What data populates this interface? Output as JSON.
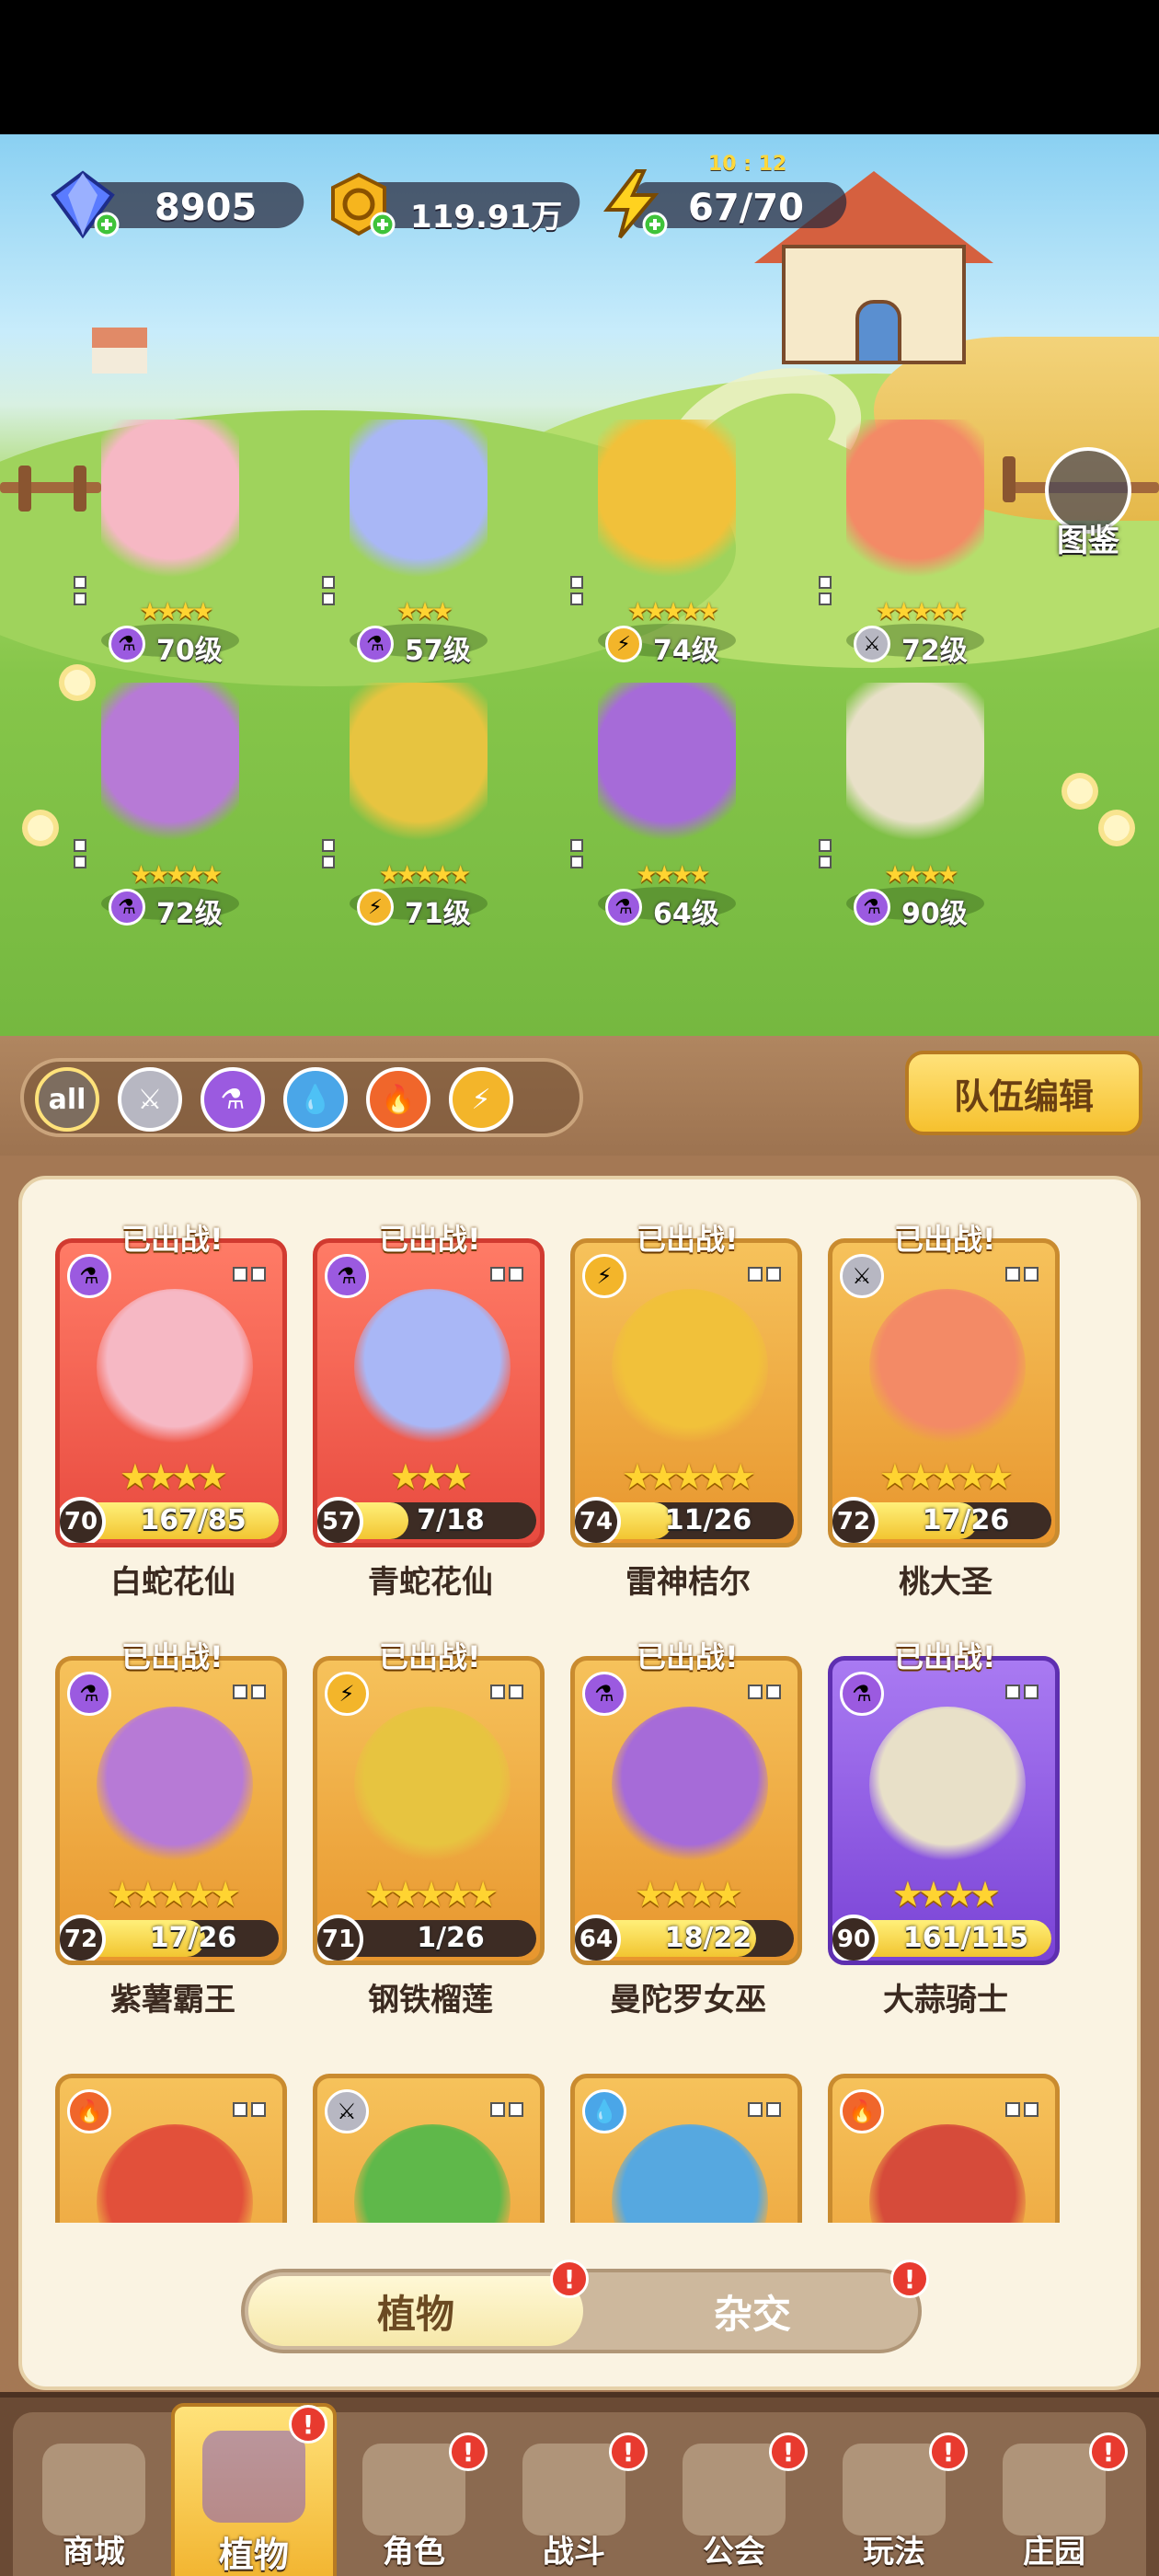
{
  "resources": {
    "gems": "8905",
    "coins": "119.91万",
    "energy": "67/70",
    "energy_timer": "10 : 12"
  },
  "dex_label": "图鉴",
  "field_units": [
    {
      "level": "70级",
      "stars": "★★★★",
      "element": "purple"
    },
    {
      "level": "57级",
      "stars": "★★★",
      "element": "purple"
    },
    {
      "level": "74级",
      "stars": "★★★★★",
      "element": "lightning"
    },
    {
      "level": "72级",
      "stars": "★★★★★",
      "element": "sword"
    },
    {
      "level": "72级",
      "stars": "★★★★★",
      "element": "purple"
    },
    {
      "level": "71级",
      "stars": "★★★★★",
      "element": "lightning"
    },
    {
      "level": "64级",
      "stars": "★★★★",
      "element": "purple"
    },
    {
      "level": "90级",
      "stars": "★★★★",
      "element": "purple"
    }
  ],
  "filters": {
    "all_label": "all",
    "team_edit": "队伍编辑"
  },
  "cards": [
    {
      "name": "白蛇花仙",
      "badge": "已出战!",
      "level": "70",
      "fragments": "167/85",
      "stars": "★★★★",
      "color": "red",
      "element": "purple",
      "progress": 1.0
    },
    {
      "name": "青蛇花仙",
      "badge": "已出战!",
      "level": "57",
      "fragments": "7/18",
      "stars": "★★★",
      "color": "red",
      "element": "purple",
      "progress": 0.39
    },
    {
      "name": "雷神桔尔",
      "badge": "已出战!",
      "level": "74",
      "fragments": "11/26",
      "stars": "★★★★★",
      "color": "gold",
      "element": "lightning",
      "progress": 0.42
    },
    {
      "name": "桃大圣",
      "badge": "已出战!",
      "level": "72",
      "fragments": "17/26",
      "stars": "★★★★★",
      "color": "gold",
      "element": "sword",
      "progress": 0.65
    },
    {
      "name": "紫薯霸王",
      "badge": "已出战!",
      "level": "72",
      "fragments": "17/26",
      "stars": "★★★★★",
      "color": "gold",
      "element": "purple",
      "progress": 0.65
    },
    {
      "name": "钢铁榴莲",
      "badge": "已出战!",
      "level": "71",
      "fragments": "1/26",
      "stars": "★★★★★",
      "color": "gold",
      "element": "lightning",
      "progress": 0.04
    },
    {
      "name": "曼陀罗女巫",
      "badge": "已出战!",
      "level": "64",
      "fragments": "18/22",
      "stars": "★★★★",
      "color": "gold",
      "element": "purple",
      "progress": 0.82
    },
    {
      "name": "大蒜骑士",
      "badge": "已出战!",
      "level": "90",
      "fragments": "161/115",
      "stars": "★★★★",
      "color": "purple",
      "element": "purple",
      "progress": 1.0
    }
  ],
  "partial_cards": [
    {
      "element": "fire"
    },
    {
      "element": "sword"
    },
    {
      "element": "water"
    },
    {
      "element": "fire"
    }
  ],
  "switch": {
    "plants": "植物",
    "hybrid": "杂交",
    "alert": "!"
  },
  "nav": [
    {
      "label": "商城",
      "alert": false
    },
    {
      "label": "植物",
      "alert": true
    },
    {
      "label": "角色",
      "alert": true
    },
    {
      "label": "战斗",
      "alert": true
    },
    {
      "label": "公会",
      "alert": true
    },
    {
      "label": "玩法",
      "alert": true
    },
    {
      "label": "庄园",
      "alert": true
    }
  ],
  "colors": {
    "purple_element": "#9b5ae0",
    "lightning_element": "#f3b52a",
    "sword_element": "#b7b7c2",
    "water_element": "#4aa6e8",
    "fire_element": "#f0662b"
  }
}
